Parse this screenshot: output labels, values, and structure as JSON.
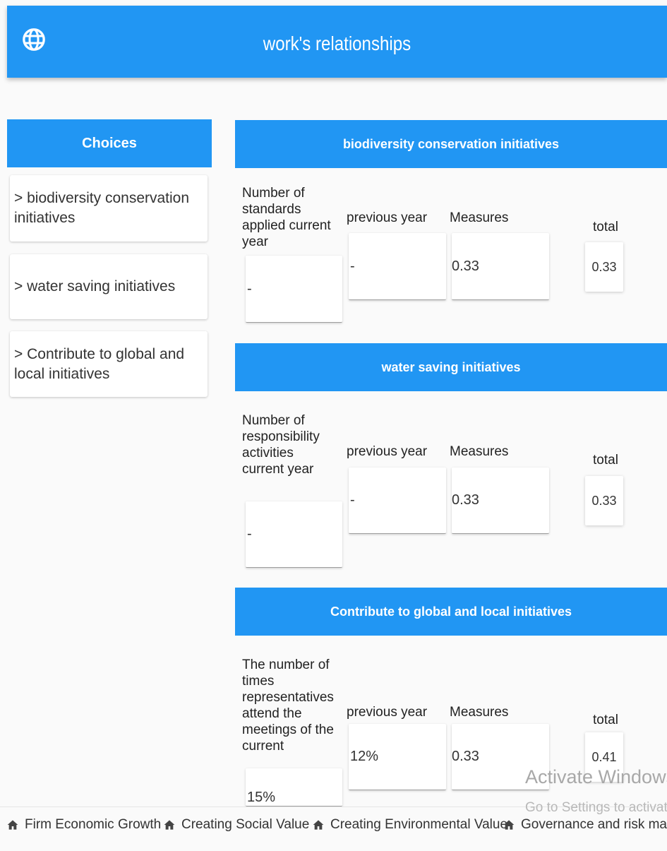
{
  "app": {
    "title": "work's relationships",
    "icon": "globe-icon"
  },
  "sidebar": {
    "header": "Choices",
    "items": [
      {
        "label": "> biodiversity conservation initiatives"
      },
      {
        "label": "> water saving initiatives"
      },
      {
        "label": "> Contribute to global and local initiatives"
      }
    ]
  },
  "sections": [
    {
      "title": "biodiversity conservation initiatives",
      "current_label": "Number of standards applied current year",
      "current_value": "-",
      "previous_label": "previous year",
      "previous_value": "-",
      "measures_label": "Measures",
      "measures_value": "0.33",
      "total_label": "total",
      "total_value": "0.33"
    },
    {
      "title": "water saving initiatives",
      "current_label": "Number of responsibility activities current year",
      "current_value": "-",
      "previous_label": "previous year",
      "previous_value": "-",
      "measures_label": "Measures",
      "measures_value": "0.33",
      "total_label": "total",
      "total_value": "0.33"
    },
    {
      "title": "Contribute to global and local initiatives",
      "current_label": "The number of times representatives attend the meetings of the current",
      "current_value": "15%",
      "previous_label": "previous year",
      "previous_value": "12%",
      "measures_label": "Measures",
      "measures_value": "0.33",
      "total_label": "total",
      "total_value": "0.41"
    }
  ],
  "watermark": {
    "line1": "Activate Windows",
    "line2": "Go to Settings to activate W"
  },
  "bottom_nav": [
    {
      "label": "Firm Economic Growth",
      "icon": "home-icon"
    },
    {
      "label": "Creating Social Value",
      "icon": "home-icon"
    },
    {
      "label": "Creating Environmental Value",
      "icon": "home-icon"
    },
    {
      "label": "Governance and risk manage",
      "icon": "home-icon"
    }
  ],
  "colors": {
    "primary": "#2196f3"
  }
}
